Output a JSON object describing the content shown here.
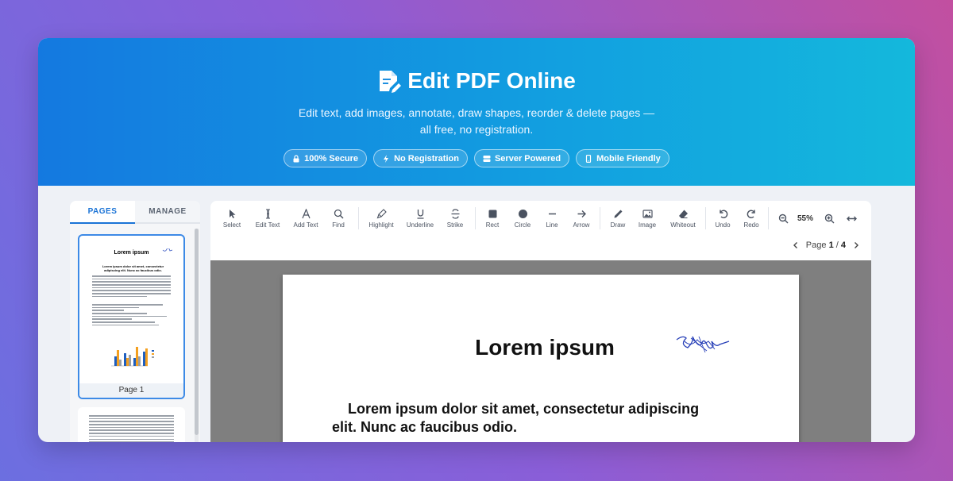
{
  "hero": {
    "title": "Edit PDF Online",
    "subtitle_line1": "Edit text, add images, annotate, draw shapes, reorder & delete pages —",
    "subtitle_line2": "all free, no registration.",
    "badges": [
      {
        "label": "100% Secure",
        "icon": "lock-icon"
      },
      {
        "label": "No Registration",
        "icon": "bolt-icon"
      },
      {
        "label": "Server Powered",
        "icon": "server-icon"
      },
      {
        "label": "Mobile Friendly",
        "icon": "mobile-icon"
      }
    ]
  },
  "sidebar": {
    "tabs": [
      {
        "label": "PAGES",
        "active": true
      },
      {
        "label": "MANAGE",
        "active": false
      }
    ],
    "thumbnails": [
      {
        "label": "Page 1",
        "title": "Lorem ipsum",
        "heading": "Lorem ipsum dolor sit amet, consectetur adipiscing elit. Nunc ac faucibus odio."
      }
    ]
  },
  "toolbar": {
    "tools": [
      {
        "label": "Select",
        "icon": "cursor-icon"
      },
      {
        "label": "Edit Text",
        "icon": "text-cursor-icon"
      },
      {
        "label": "Add Text",
        "icon": "font-icon"
      },
      {
        "label": "Find",
        "icon": "search-icon"
      },
      {
        "label": "Highlight",
        "icon": "highlighter-icon"
      },
      {
        "label": "Underline",
        "icon": "underline-icon"
      },
      {
        "label": "Strike",
        "icon": "strikethrough-icon"
      },
      {
        "label": "Rect",
        "icon": "square-icon"
      },
      {
        "label": "Circle",
        "icon": "circle-icon"
      },
      {
        "label": "Line",
        "icon": "line-icon"
      },
      {
        "label": "Arrow",
        "icon": "arrow-right-icon"
      },
      {
        "label": "Draw",
        "icon": "pen-icon"
      },
      {
        "label": "Image",
        "icon": "image-icon"
      },
      {
        "label": "Whiteout",
        "icon": "eraser-icon"
      },
      {
        "label": "Undo",
        "icon": "undo-icon"
      },
      {
        "label": "Redo",
        "icon": "redo-icon"
      }
    ],
    "zoom": "55%"
  },
  "pager": {
    "prefix": "Page",
    "current": "1",
    "separator": "/",
    "total": "4"
  },
  "document": {
    "title": "Lorem ipsum",
    "heading_line1": "Lorem ipsum dolor sit amet, consectetur adipiscing",
    "heading_line2": "elit. Nunc ac faucibus odio."
  },
  "colors": {
    "accent": "#1a73d6",
    "hero_start": "#1479e0",
    "hero_end": "#14b8dc"
  }
}
